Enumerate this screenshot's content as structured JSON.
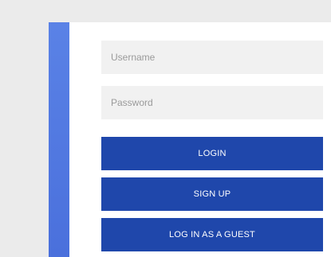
{
  "login_form": {
    "username": {
      "placeholder": "Username",
      "value": ""
    },
    "password": {
      "placeholder": "Password",
      "value": ""
    },
    "buttons": {
      "login": "LOGIN",
      "signup": "SIGN UP",
      "guest": "LOG IN AS A GUEST"
    }
  },
  "colors": {
    "page_background": "#ebebeb",
    "accent_strip": "#5a82e6",
    "card_background": "#ffffff",
    "input_background": "#f1f1f1",
    "button_background": "#1f47ab",
    "button_text": "#ffffff",
    "placeholder_text": "#9a9a9a"
  }
}
